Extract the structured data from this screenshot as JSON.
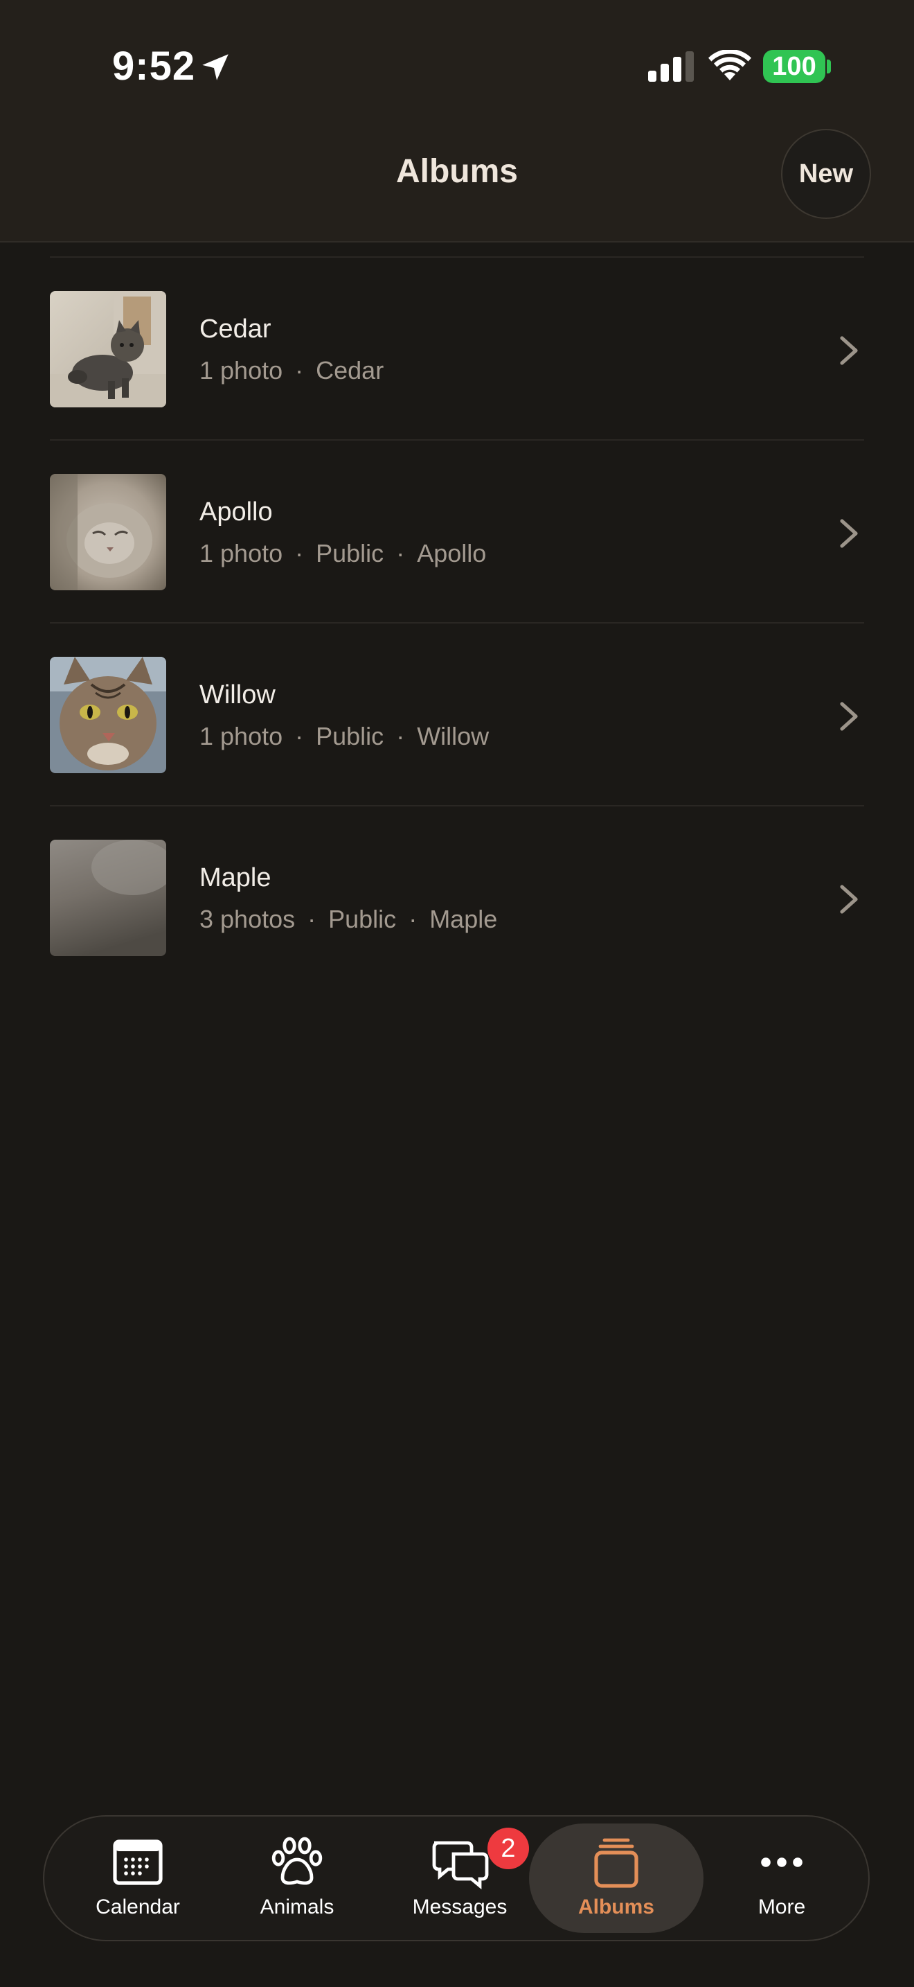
{
  "status_bar": {
    "time": "9:52",
    "battery": "100"
  },
  "header": {
    "title": "Albums",
    "new_label": "New"
  },
  "albums": [
    {
      "name": "Cedar",
      "count": "1 photo",
      "tags": [
        "Cedar"
      ]
    },
    {
      "name": "Apollo",
      "count": "1 photo",
      "tags": [
        "Public",
        "Apollo"
      ]
    },
    {
      "name": "Willow",
      "count": "1 photo",
      "tags": [
        "Public",
        "Willow"
      ]
    },
    {
      "name": "Maple",
      "count": "3 photos",
      "tags": [
        "Public",
        "Maple"
      ]
    }
  ],
  "meta_separator": "·",
  "tabs": [
    {
      "label": "Calendar",
      "icon": "calendar-icon"
    },
    {
      "label": "Animals",
      "icon": "paw-icon"
    },
    {
      "label": "Messages",
      "icon": "messages-icon",
      "badge": "2"
    },
    {
      "label": "Albums",
      "icon": "albums-icon",
      "active": true
    },
    {
      "label": "More",
      "icon": "more-icon"
    }
  ],
  "colors": {
    "accent": "#e48f58",
    "badge": "#ee3a3f",
    "battery": "#30c453",
    "background": "#1a1815"
  }
}
